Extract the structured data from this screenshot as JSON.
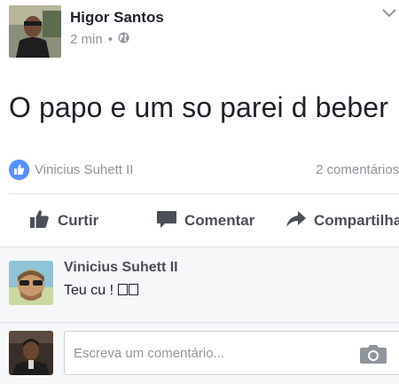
{
  "post": {
    "author": "Higor Santos",
    "time": "2 min",
    "separator": "•",
    "privacy_icon": "globe-icon",
    "text": "O papo e um so parei d beber"
  },
  "reactions": {
    "icon": "like-icon",
    "reactor": "Vinicius Suhett II",
    "comments_count": "2 comentários"
  },
  "actions": {
    "like": "Curtir",
    "comment": "Comentar",
    "share": "Compartilhar"
  },
  "comments": [
    {
      "author": "Vinicius Suhett II",
      "text": "Teu cu ! "
    }
  ],
  "composer": {
    "placeholder": "Escreva um comentário...",
    "camera_icon": "camera-icon"
  },
  "colors": {
    "brand_blue": "#5890ff",
    "text_primary": "#1d2129",
    "text_secondary": "#90949c",
    "action_grey": "#4b4f56",
    "comments_bg": "#f6f7f9"
  }
}
